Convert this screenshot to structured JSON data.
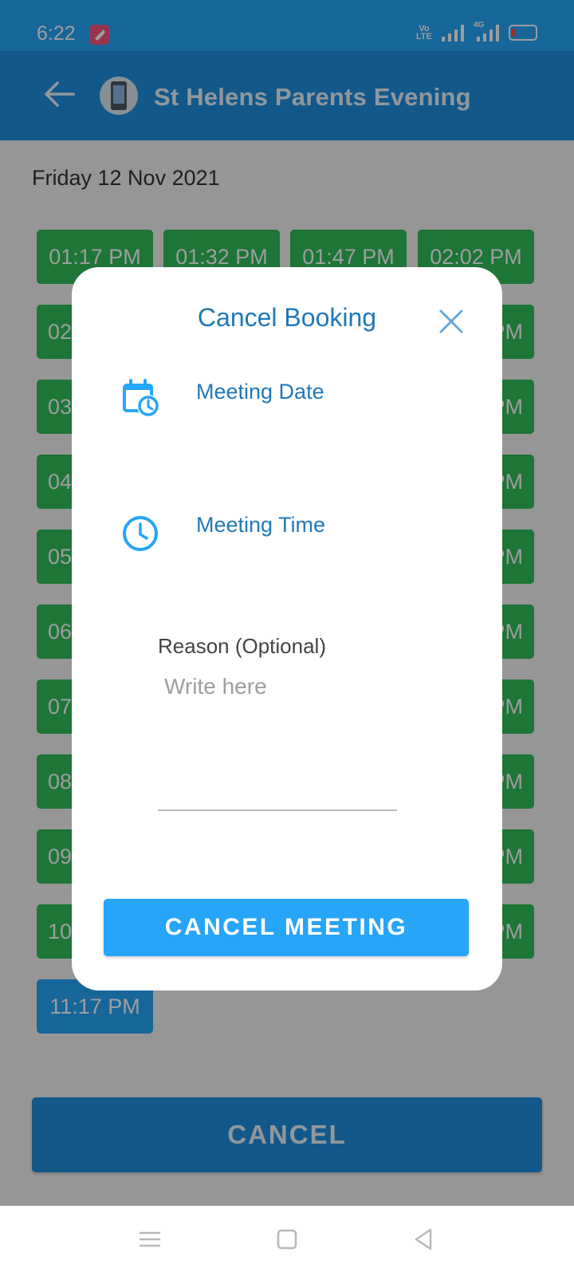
{
  "status_bar": {
    "time": "6:22",
    "volte_label_top": "Vo",
    "volte_label_bottom": "LTE",
    "network_label": "4G",
    "icons": [
      "app-notification-icon",
      "volte-icon",
      "signal-icon",
      "signal-4g-icon",
      "battery-icon"
    ]
  },
  "app_bar": {
    "title": "St Helens Parents Evening",
    "back_icon": "arrow-left-icon"
  },
  "schedule": {
    "date": "Friday 12 Nov 2021",
    "slots": [
      "01:17 PM",
      "01:32 PM",
      "01:47 PM",
      "02:02 PM"
    ],
    "row_prefixes": [
      "02",
      "03",
      "04",
      "05",
      "06",
      "07",
      "08",
      "09",
      "10"
    ],
    "row_suffix": "PM",
    "selected_slot": "11:17 PM",
    "cancel_label": "CANCEL"
  },
  "dialog": {
    "title": "Cancel Booking",
    "meeting_date_label": "Meeting Date",
    "meeting_time_label": "Meeting Time",
    "reason_label": "Reason (Optional)",
    "reason_placeholder": "Write here",
    "reason_value": "",
    "cancel_meeting_label": "CANCEL MEETING"
  },
  "nav_bar": {
    "icons": [
      "menu-icon",
      "home-icon",
      "back-icon"
    ]
  },
  "colors": {
    "status_bar": "#26a5f9",
    "app_bar": "#1d8fe0",
    "slot_available": "#2fbd57",
    "slot_booked": "#26a5f9",
    "accent_text": "#1f78b8"
  }
}
